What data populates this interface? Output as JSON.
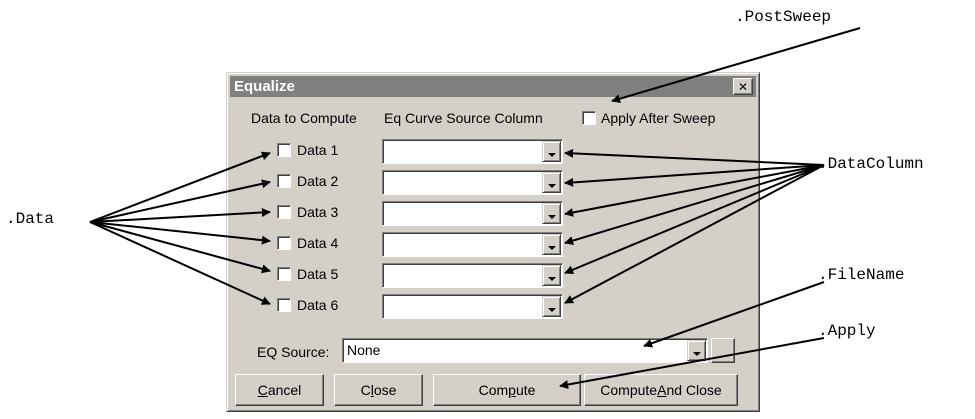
{
  "annotations": {
    "post_sweep": ".PostSweep",
    "data_column": ".DataColumn",
    "data": ".Data",
    "file_name": ".FileName",
    "apply": ".Apply"
  },
  "dialog": {
    "title": "Equalize",
    "close_glyph": "✕",
    "header_data_to_compute": "Data to Compute",
    "header_eq_curve_source_column": "Eq Curve Source Column",
    "apply_after_sweep_label": "Apply After Sweep",
    "apply_after_sweep_checked": false,
    "rows": [
      {
        "label": "Data 1",
        "checked": false,
        "column_value": ""
      },
      {
        "label": "Data 2",
        "checked": false,
        "column_value": ""
      },
      {
        "label": "Data 3",
        "checked": false,
        "column_value": ""
      },
      {
        "label": "Data 4",
        "checked": false,
        "column_value": ""
      },
      {
        "label": "Data 5",
        "checked": false,
        "column_value": ""
      },
      {
        "label": "Data 6",
        "checked": false,
        "column_value": ""
      }
    ],
    "eq_source_label": "EQ Source:",
    "eq_source_value": "None",
    "buttons": {
      "cancel": {
        "pre": "",
        "u": "C",
        "post": "ancel"
      },
      "close": {
        "pre": "C",
        "u": "l",
        "post": "ose"
      },
      "compute": {
        "pre": "Com",
        "u": "p",
        "post": "ute"
      },
      "compute_and_close": {
        "pre": "Compute ",
        "u": "A",
        "post": "nd Close"
      }
    }
  },
  "icons": {
    "close": "close-icon",
    "dropdown": "chevron-down-icon"
  }
}
